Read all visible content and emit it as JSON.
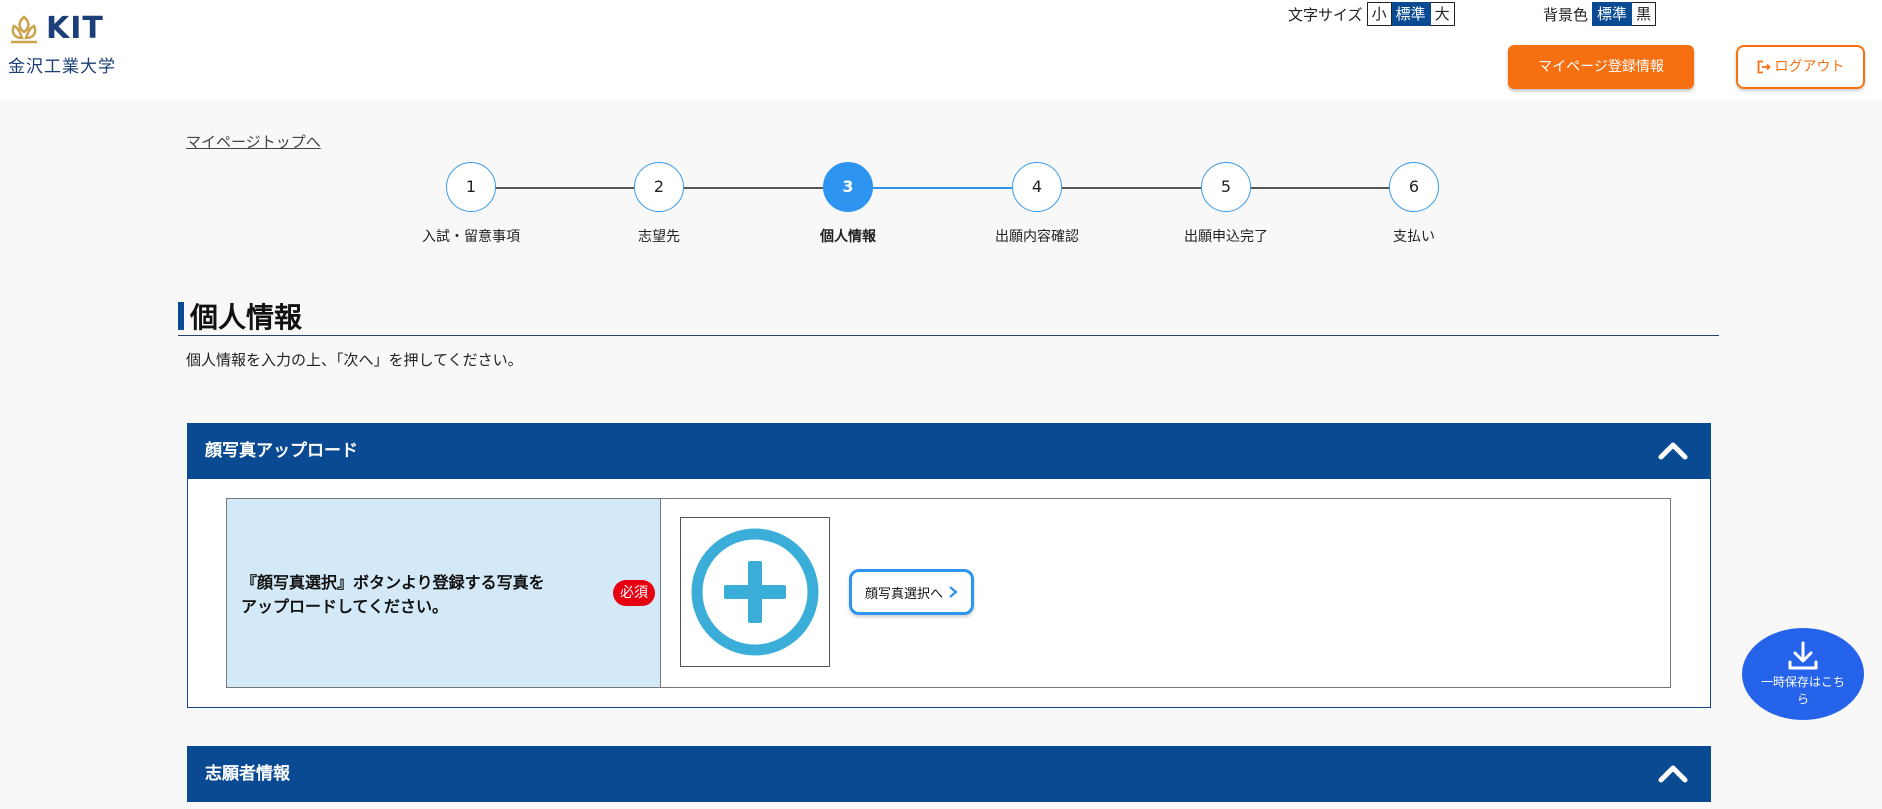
{
  "header": {
    "logo_text": "KIT",
    "logo_subtitle": "金沢工業大学",
    "font_size": {
      "label": "文字サイズ",
      "options": [
        "小",
        "標準",
        "大"
      ],
      "selected": "標準"
    },
    "background": {
      "label": "背景色",
      "options": [
        "標準",
        "黒"
      ],
      "selected": "標準"
    },
    "mypage_button": "マイページ登録情報",
    "logout_button": "ログアウト"
  },
  "nav": {
    "top_link": "マイページトップへ"
  },
  "steps": [
    {
      "number": "1",
      "label": "入試・留意事項"
    },
    {
      "number": "2",
      "label": "志望先"
    },
    {
      "number": "3",
      "label": "個人情報"
    },
    {
      "number": "4",
      "label": "出願内容確認"
    },
    {
      "number": "5",
      "label": "出願申込完了"
    },
    {
      "number": "6",
      "label": "支払い"
    }
  ],
  "current_step": 3,
  "page": {
    "title": "個人情報",
    "description": "個人情報を入力の上、「次へ」を押してください。"
  },
  "sections": [
    {
      "title": "顔写真アップロード",
      "field_label_line1": "『顔写真選択』ボタンより登録する写真を",
      "field_label_line2": "アップロードしてください。",
      "required_badge": "必須",
      "select_button": "顔写真選択へ"
    },
    {
      "title": "志願者情報"
    }
  ],
  "float_save": {
    "line1": "一時保存はこち",
    "line2": "ら"
  },
  "colors": {
    "primary_navy": "#0a4a92",
    "accent_orange": "#f66f10",
    "step_active_blue": "#2d95f0",
    "required_red": "#e60012",
    "label_bg": "#d4e9f7",
    "plus_icon": "#3aaed8",
    "float_button": "#2563eb"
  }
}
